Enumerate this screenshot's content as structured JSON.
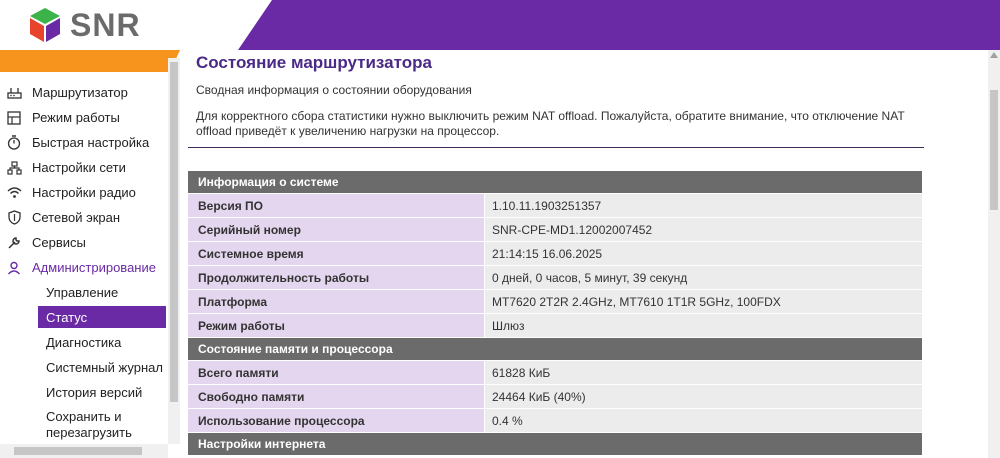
{
  "header": {
    "logo_text": "SNR",
    "colors": {
      "purple": "#6a2aa6",
      "orange": "#f7941d",
      "logo_green": "#3bb34a",
      "logo_red": "#e8432d",
      "logo_purple": "#6a2aa6"
    }
  },
  "sidebar": {
    "items": [
      {
        "label": "Маршрутизатор",
        "icon": "router-icon"
      },
      {
        "label": "Режим работы",
        "icon": "mode-icon"
      },
      {
        "label": "Быстрая настройка",
        "icon": "stopwatch-icon"
      },
      {
        "label": "Настройки сети",
        "icon": "network-icon"
      },
      {
        "label": "Настройки радио",
        "icon": "wifi-icon"
      },
      {
        "label": "Сетевой экран",
        "icon": "shield-icon"
      },
      {
        "label": "Сервисы",
        "icon": "wrench-icon"
      },
      {
        "label": "Администрирование",
        "icon": "user-icon"
      }
    ],
    "subitems": [
      {
        "label": "Управление"
      },
      {
        "label": "Статус"
      },
      {
        "label": "Диагностика"
      },
      {
        "label": "Системный журнал"
      },
      {
        "label": "История версий"
      },
      {
        "label": "Сохранить и перезагрузить"
      }
    ]
  },
  "main": {
    "title": "Состояние маршрутизатора",
    "subtitle": "Сводная информация о состоянии оборудования",
    "notice": "Для корректного сбора статистики нужно выключить режим NAT offload. Пожалуйста, обратите внимание, что отключение NAT offload приведёт к увеличению нагрузки на процессор.",
    "sections": [
      {
        "title": "Информация о системе",
        "rows": [
          {
            "key": "Версия ПО",
            "value": "1.10.11.1903251357"
          },
          {
            "key": "Серийный номер",
            "value": "SNR-CPE-MD1.12002007452"
          },
          {
            "key": "Системное время",
            "value": "21:14:15 16.06.2025"
          },
          {
            "key": "Продолжительность работы",
            "value": "0 дней, 0 часов, 5 минут, 39 секунд"
          },
          {
            "key": "Платформа",
            "value": "MT7620 2T2R 2.4GHz, MT7610 1T1R 5GHz, 100FDX"
          },
          {
            "key": "Режим работы",
            "value": "Шлюз"
          }
        ]
      },
      {
        "title": "Состояние памяти и процессора",
        "rows": [
          {
            "key": "Всего памяти",
            "value": "61828 КиБ"
          },
          {
            "key": "Свободно памяти",
            "value": "24464 КиБ (40%)"
          },
          {
            "key": "Использование процессора",
            "value": "0.4 %"
          }
        ]
      },
      {
        "title": "Настройки интернета",
        "rows": []
      }
    ]
  }
}
